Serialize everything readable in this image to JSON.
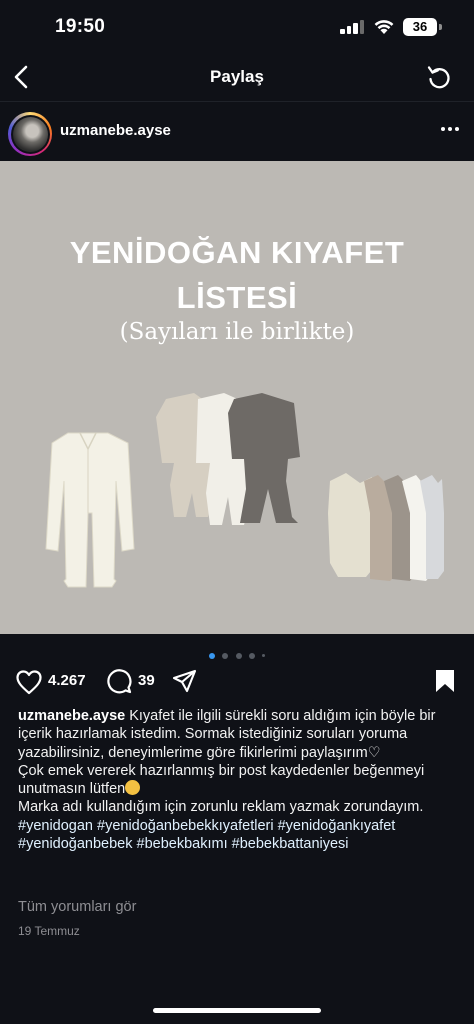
{
  "status_bar": {
    "time": "19:50",
    "battery": "36"
  },
  "nav": {
    "title": "Paylaş"
  },
  "post": {
    "username": "uzmanebe.ayse",
    "image": {
      "title_line1": "YENİDOĞAN KIYAFET",
      "title_line2": "LİSTESİ",
      "subtitle": "(Sayıları ile birlikte)"
    },
    "likes": "4.267",
    "comments": "39",
    "caption": {
      "username": "uzmanebe.ayse",
      "line1": "Kıyafet ile ilgili sürekli soru aldığım için böyle bir içerik hazırlamak istedim. Sormak istediğiniz soruları yoruma yazabilirsiniz, deneyimlerime göre fikirlerimi paylaşırım",
      "line2": "Çok emek vererek hazırlanmış bir post kaydedenler beğenmeyi unutmasın lütfen",
      "line3": "Marka adı kullandığım için zorunlu reklam yazmak zorundayım.",
      "hashtags": "#yenidogan #yenidoğanbebekkıyafetleri #yenidoğankıyafet #yenidoğanbebek #bebekbakımı #bebekbattaniyesi"
    },
    "view_all_comments": "Tüm yorumları gör",
    "date": "19 Temmuz"
  },
  "colors": {
    "accent": "#3897f0",
    "image_bg": "#bcb9b4",
    "background": "#0f1117"
  }
}
